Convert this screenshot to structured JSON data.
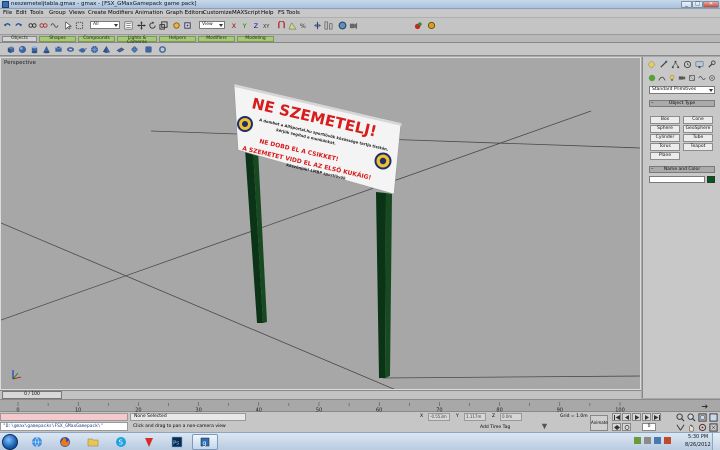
{
  "window": {
    "title": "neszemeteljtabla.gmax - gmax - [FSX_GMaxGamepack game pack]",
    "buttons": [
      "_",
      "□",
      "✕"
    ]
  },
  "menubar": [
    "File",
    "Edit",
    "Tools",
    "Group",
    "Views",
    "Create",
    "Modifiers",
    "Animation",
    "Graph Editors",
    "Customize",
    "MAXScript",
    "Help",
    "FS Tools"
  ],
  "toolbar": {
    "selection_filter": "All",
    "reference_coord": "View"
  },
  "tabs": [
    "Objects",
    "Shapes",
    "Compounds",
    "Lights & Cameras",
    "Helpers",
    "Modifiers",
    "Modeling"
  ],
  "viewport": {
    "label": "Perspective",
    "sign": {
      "headline": "NE SZEMETELJ!",
      "lines": [
        "A dombot a AllSportal.hu sportlövők közössége tartja tisztán,",
        "kérjük segítsd a munkánkat.",
        "NE DOBD EL A CSIKKET!",
        "A SZEMETET VIDD EL AZ ELSŐ KUKÁIG!",
        "Köszönjük! LMBP sportlövők"
      ],
      "colors": {
        "headline": "#d81b1b",
        "body": "#1a1a1a",
        "accent": "#d81b1b",
        "board": "#f4f4f4",
        "post": "#0d3a1a"
      }
    }
  },
  "command_panel": {
    "primitive_type": "Standard Primitives",
    "object_type_header": "Object Type",
    "object_buttons": [
      "Box",
      "Cone",
      "Sphere",
      "GeoSphere",
      "Cylinder",
      "Tube",
      "Torus",
      "Teapot",
      "Plane"
    ],
    "name_color_header": "Name and Color",
    "object_color": "#00581a"
  },
  "timeline": {
    "slider": "0 / 100",
    "ticks": [
      "0",
      "10",
      "20",
      "30",
      "40",
      "50",
      "60",
      "70",
      "80",
      "90",
      "100"
    ]
  },
  "status": {
    "maxscript_input": "\"D:\\gmax\\gamepacks\\FSX_GMaxGamepack\\\"",
    "selection": "None Selected",
    "prompt": "Click and drag to pan a non-camera view",
    "coords": {
      "x_label": "X",
      "x_value": "-0.553m",
      "y_label": "Y",
      "y_value": "1.117m",
      "z_label": "Z",
      "z_value": "0.0m"
    },
    "grid": "Grid = 1.0m",
    "add_time_tag": "Add Time Tag",
    "animate": "Animate",
    "frame": "0"
  },
  "taskbar": {
    "apps": [
      "explorer",
      "firefox",
      "folder",
      "skype",
      "flashget",
      "photoshop",
      "gmax"
    ],
    "time": "5:30 PM",
    "date": "8/26/2012"
  }
}
